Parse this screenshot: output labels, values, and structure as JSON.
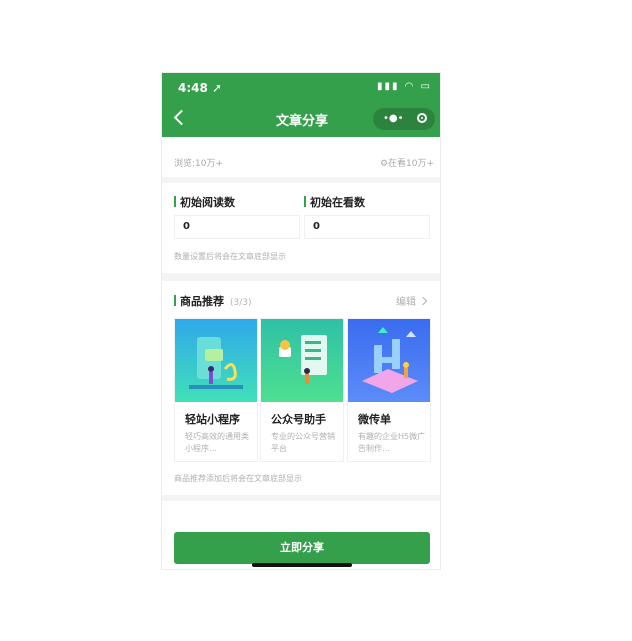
{
  "status_bar": {
    "time": "4:48 ➚",
    "icons": "▮▮▮ ◠ ▭"
  },
  "nav": {
    "title": "文章分享"
  },
  "stats": {
    "views": "浏览:10万+",
    "watching": "⚙在看10万+"
  },
  "initial": {
    "read_label": "初始阅读数",
    "watch_label": "初始在看数",
    "read_value": "0",
    "watch_value": "0",
    "hint": "数量设置后将会在文章底部显示"
  },
  "goods": {
    "title": "商品推荐",
    "count": "(3/3)",
    "edit": "编辑",
    "items": [
      {
        "name": "轻站小程序",
        "desc": "轻巧高效的通用类小程序…"
      },
      {
        "name": "公众号助手",
        "desc": "专业的公众号营销平台"
      },
      {
        "name": "微传单",
        "desc": "有趣的企业H5微广告制作…"
      }
    ],
    "hint": "商品推荐添加后将会在文章底部显示"
  },
  "share_button": "立即分享",
  "colors": {
    "brand": "#35a04c",
    "muted_text": "#b0b0b0",
    "gap": "#f4f4f4"
  }
}
